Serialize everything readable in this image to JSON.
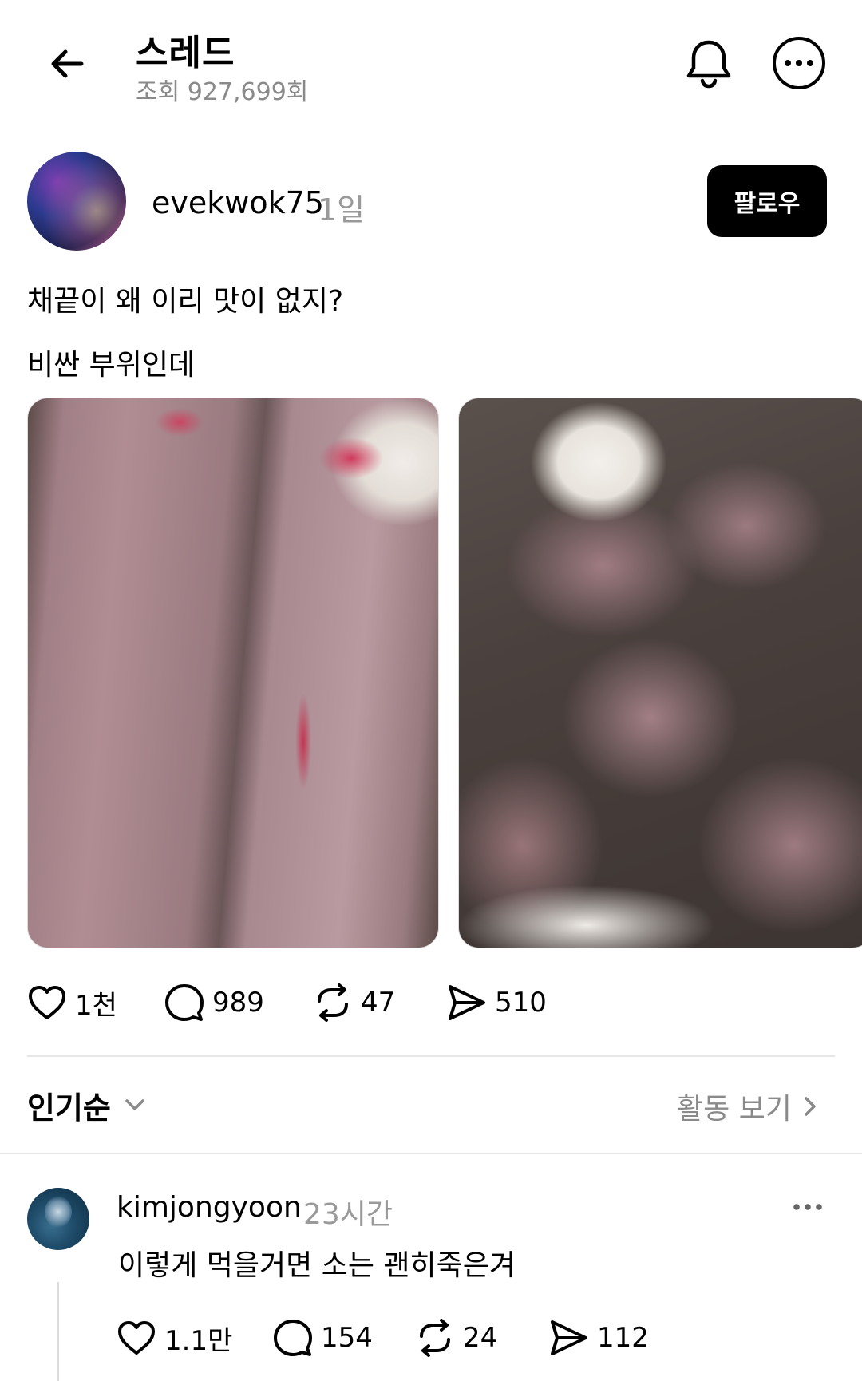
{
  "header": {
    "title": "스레드",
    "views": "조회 927,699회"
  },
  "post": {
    "author": "evekwok75",
    "time": "1일",
    "follow_label": "팔로우",
    "lines": [
      "채끝이 왜 이리 맛이 없지?",
      "비싼 부위인데"
    ],
    "stats": {
      "likes": "1천",
      "comments": "989",
      "reposts": "47",
      "shares": "510"
    }
  },
  "sort": {
    "label": "인기순",
    "activity_label": "활동 보기"
  },
  "comment": {
    "author": "kimjongyoon",
    "time": "23시간",
    "text": "이렇게 먹을거면 소는 괜히죽은겨",
    "stats": {
      "likes": "1.1만",
      "comments": "154",
      "reposts": "24",
      "shares": "112"
    }
  }
}
